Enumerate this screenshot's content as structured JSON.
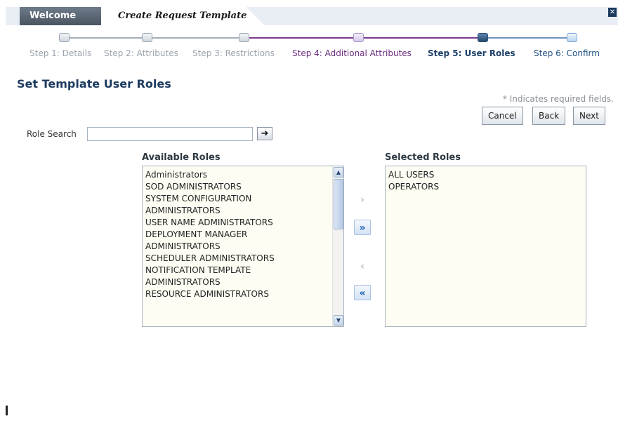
{
  "tabs": {
    "welcome": "Welcome",
    "create": "Create Request Template"
  },
  "close_icon": "close-icon",
  "train": {
    "steps": [
      {
        "label": "Step 1: Details",
        "state": "unvisited"
      },
      {
        "label": "Step 2: Attributes",
        "state": "unvisited"
      },
      {
        "label": "Step 3: Restrictions",
        "state": "unvisited"
      },
      {
        "label": "Step 4: Additional Attributes",
        "state": "visited"
      },
      {
        "label": "Step 5: User Roles",
        "state": "current"
      },
      {
        "label": "Step 6: Confirm",
        "state": "next"
      }
    ]
  },
  "page": {
    "title": "Set Template User Roles",
    "required_note": "* Indicates required fields."
  },
  "buttons": {
    "cancel": "Cancel",
    "back": "Back",
    "next": "Next"
  },
  "search": {
    "label": "Role Search",
    "value": "",
    "go_icon": "arrow-right-icon"
  },
  "available": {
    "header": "Available Roles",
    "items": [
      "Administrators",
      "SOD ADMINISTRATORS",
      "SYSTEM CONFIGURATION",
      "ADMINISTRATORS",
      "USER NAME ADMINISTRATORS",
      "DEPLOYMENT MANAGER",
      "ADMINISTRATORS",
      "SCHEDULER ADMINISTRATORS",
      "NOTIFICATION TEMPLATE",
      "ADMINISTRATORS",
      "RESOURCE ADMINISTRATORS"
    ]
  },
  "selected": {
    "header": "Selected Roles",
    "items": [
      "ALL USERS",
      "OPERATORS"
    ]
  },
  "shuttle": {
    "move": "›",
    "move_all": "»",
    "remove": "‹",
    "remove_all": "«"
  },
  "colors": {
    "current_step": "#1c3f68",
    "visited_step": "#6a2b7d",
    "list_bg": "#fdfdf3"
  }
}
